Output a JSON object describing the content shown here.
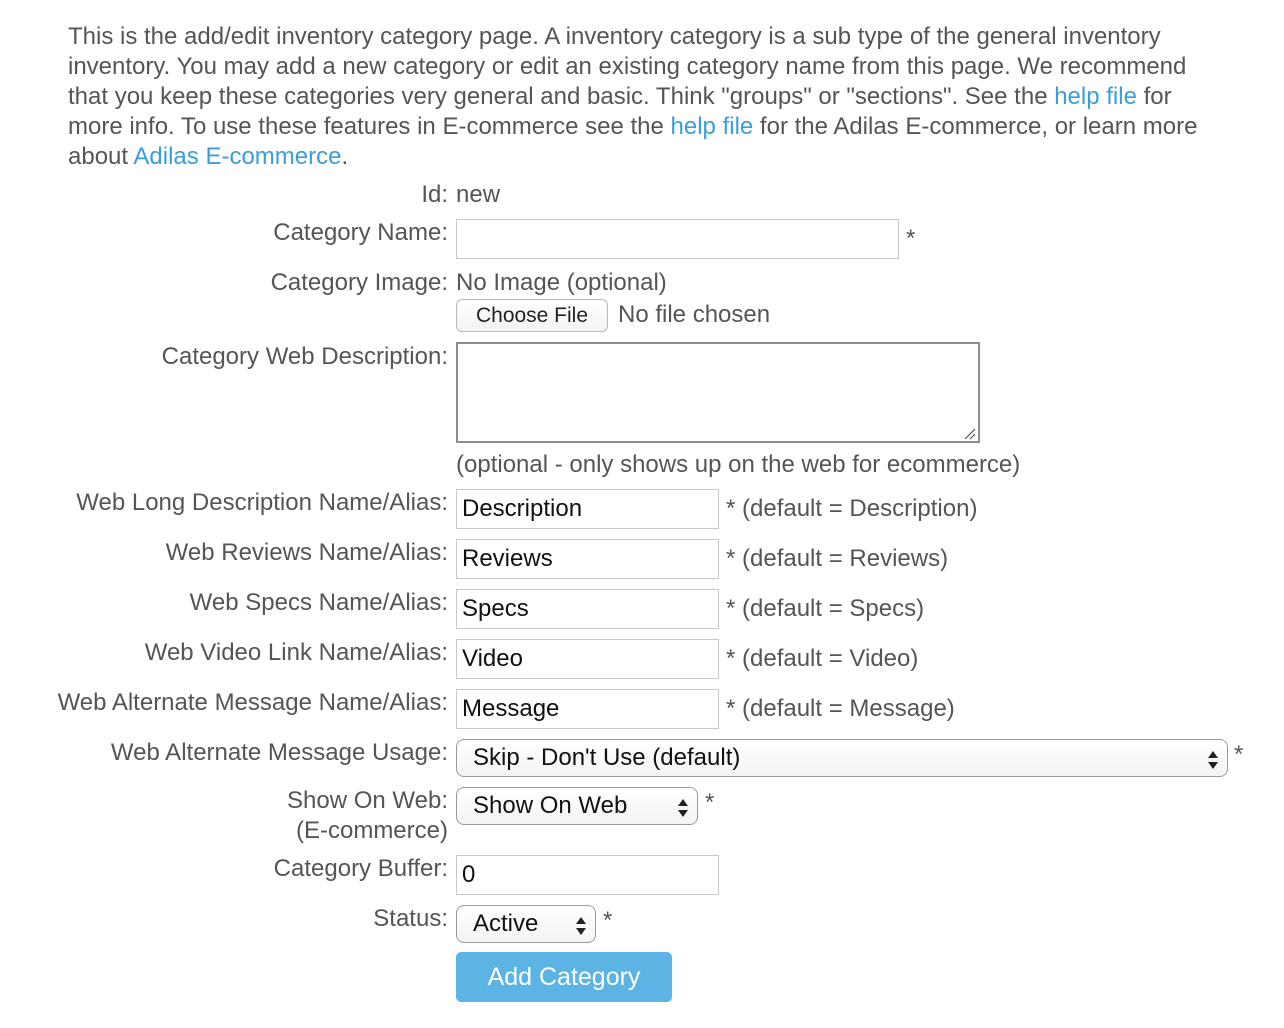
{
  "intro": {
    "part1": "This is the add/edit inventory category page. A inventory category is a sub type of the general inventory inventory. You may add a new category or edit an existing category name from this page. We recommend that you keep these categories very general and basic. Think \"groups\" or \"sections\". See the ",
    "link1": "help file",
    "part2": " for more info. To use these features in E-commerce see the ",
    "link2": "help file",
    "part3": " for the Adilas E-commerce, or learn more about ",
    "link3": "Adilas E-commerce",
    "part4": "."
  },
  "form": {
    "id_label": "Id:",
    "id_value": "new",
    "category_name_label": "Category Name:",
    "category_name_value": "",
    "required_star": "*",
    "category_image_label": "Category Image:",
    "category_image_value": "No Image (optional)",
    "choose_file_label": "Choose File",
    "no_file_text": "No file chosen",
    "web_description_label": "Category Web Description:",
    "web_description_value": "",
    "web_description_hint": "(optional - only shows up on the web for ecommerce)",
    "long_desc_label": "Web Long Description Name/Alias:",
    "long_desc_value": "Description",
    "long_desc_hint": "* (default = Description)",
    "reviews_label": "Web Reviews Name/Alias:",
    "reviews_value": "Reviews",
    "reviews_hint": "* (default = Reviews)",
    "specs_label": "Web Specs Name/Alias:",
    "specs_value": "Specs",
    "specs_hint": "* (default = Specs)",
    "video_label": "Web Video Link Name/Alias:",
    "video_value": "Video",
    "video_hint": "* (default = Video)",
    "alt_message_label": "Web Alternate Message Name/Alias:",
    "alt_message_value": "Message",
    "alt_message_hint": "* (default = Message)",
    "alt_usage_label": "Web Alternate Message Usage:",
    "alt_usage_selected": "Skip - Don't Use (default)",
    "show_on_web_label_line1": "Show On Web:",
    "show_on_web_label_line2": "(E-commerce)",
    "show_on_web_selected": "Show On Web",
    "buffer_label": "Category Buffer:",
    "buffer_value": "0",
    "status_label": "Status:",
    "status_selected": "Active",
    "submit_label": "Add Category"
  },
  "colors": {
    "link": "#3a9ed9",
    "text": "#555555",
    "button": "#5bb4e3"
  }
}
